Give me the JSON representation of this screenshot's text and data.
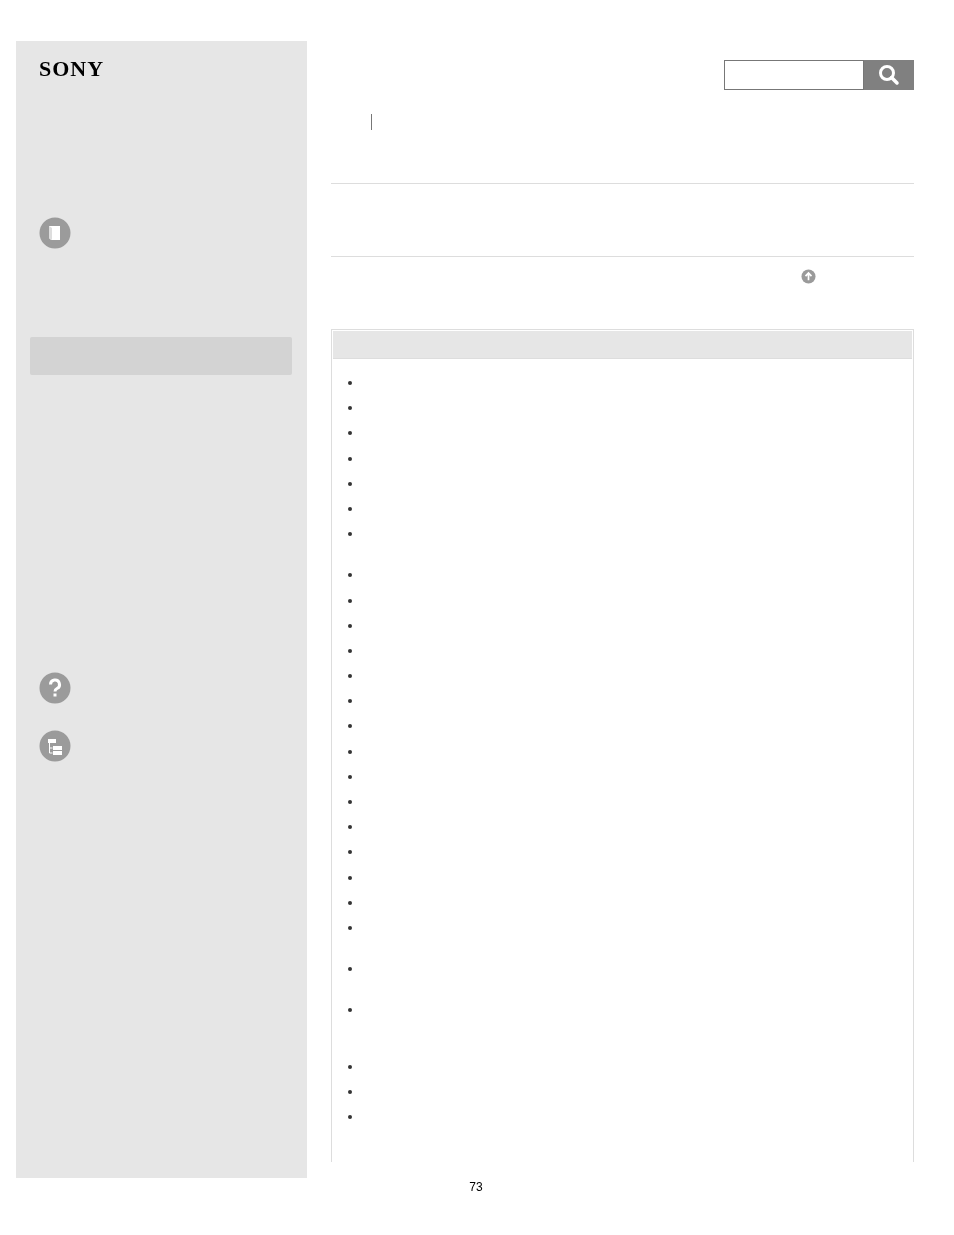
{
  "sidebar": {
    "logo": "SONY",
    "items": [
      {
        "kind": "book"
      },
      {
        "kind": "panel"
      },
      {
        "kind": "help"
      },
      {
        "kind": "tree"
      }
    ]
  },
  "search": {
    "kind": "search"
  },
  "content": {
    "list_groups": [
      {
        "items": [
          {
            "kind": "bullet"
          },
          {
            "kind": "bullet"
          },
          {
            "kind": "bullet"
          },
          {
            "kind": "bullet"
          },
          {
            "kind": "bullet"
          },
          {
            "kind": "bullet"
          },
          {
            "kind": "bullet"
          }
        ]
      },
      {
        "items": [
          {
            "kind": "bullet"
          },
          {
            "kind": "bullet"
          },
          {
            "kind": "bullet"
          },
          {
            "kind": "bullet"
          },
          {
            "kind": "bullet"
          },
          {
            "kind": "bullet"
          },
          {
            "kind": "bullet"
          },
          {
            "kind": "bullet"
          },
          {
            "kind": "bullet"
          },
          {
            "kind": "bullet"
          },
          {
            "kind": "bullet"
          },
          {
            "kind": "bullet"
          },
          {
            "kind": "bullet"
          },
          {
            "kind": "bullet"
          },
          {
            "kind": "tall_bullet"
          },
          {
            "kind": "tall_bullet"
          },
          {
            "kind": "tall_bullet"
          }
        ]
      },
      {
        "items": [
          {
            "kind": "bullet"
          },
          {
            "kind": "bullet"
          },
          {
            "kind": "bullet"
          }
        ]
      }
    ]
  },
  "page_number": "73"
}
